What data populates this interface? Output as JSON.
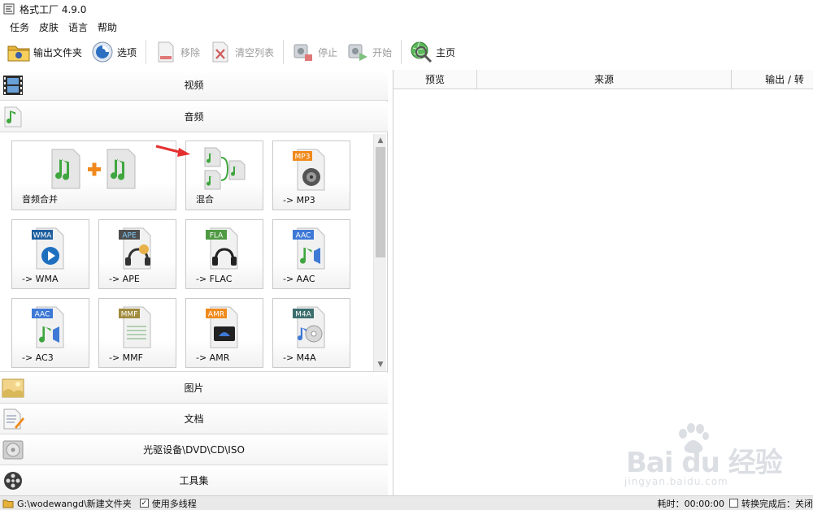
{
  "window": {
    "title": "格式工厂 4.9.0"
  },
  "menu": [
    "任务",
    "皮肤",
    "语言",
    "帮助"
  ],
  "toolbar": {
    "output_folder": "输出文件夹",
    "options": "选项",
    "remove": "移除",
    "clear_list": "清空列表",
    "stop": "停止",
    "start": "开始",
    "home": "主页"
  },
  "categories": {
    "video": "视频",
    "audio": "音频",
    "picture": "图片",
    "document": "文档",
    "rom": "光驱设备\\DVD\\CD\\ISO",
    "tools": "工具集"
  },
  "audio_tiles": [
    {
      "label": "音频合并",
      "icon": "audio-merge-icon"
    },
    {
      "label": "混合",
      "icon": "audio-mix-icon"
    },
    {
      "label": "-> MP3",
      "icon": "mp3-icon",
      "badge": "MP3",
      "badge_color": "#f08a1c"
    },
    {
      "label": "-> WMA",
      "icon": "wma-icon",
      "badge": "WMA",
      "badge_color": "#1f5f9f"
    },
    {
      "label": "-> APE",
      "icon": "ape-icon",
      "badge": "APE",
      "badge_color": "#4d4d4d"
    },
    {
      "label": "-> FLAC",
      "icon": "flac-icon",
      "badge": "FLA",
      "badge_color": "#4f9a43"
    },
    {
      "label": "-> AAC",
      "icon": "aac-icon",
      "badge": "AAC",
      "badge_color": "#3e79d6"
    },
    {
      "label": "-> AC3",
      "icon": "ac3-icon",
      "badge": "AAC",
      "badge_color": "#3e79d6"
    },
    {
      "label": "-> MMF",
      "icon": "mmf-icon",
      "badge": "MMF",
      "badge_color": "#a08a3c"
    },
    {
      "label": "-> AMR",
      "icon": "amr-icon",
      "badge": "AMR",
      "badge_color": "#f08a1c"
    },
    {
      "label": "-> M4A",
      "icon": "m4a-icon",
      "badge": "M4A",
      "badge_color": "#3c6e6e"
    }
  ],
  "task_table": {
    "columns": [
      "预览",
      "来源",
      "输出 / 转"
    ]
  },
  "statusbar": {
    "output_path": "G:\\wodewangd\\新建文件夹",
    "multithread_label": "使用多线程",
    "multithread_checked": true,
    "elapsed_label": "耗时：00:00:00",
    "after_done_label": "转换完成后：关闭"
  },
  "watermark": {
    "brand": "Bai du 经验",
    "url": "jingyan.baidu.com"
  }
}
